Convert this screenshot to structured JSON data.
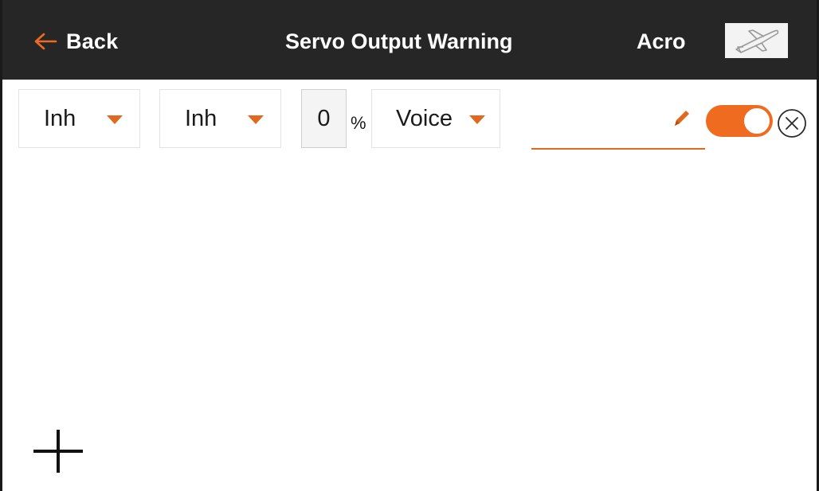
{
  "header": {
    "back_label": "Back",
    "title": "Servo Output Warning",
    "model_name": "Acro",
    "model_icon": "airplane-icon"
  },
  "row": {
    "dropdown_1": "Inh",
    "dropdown_2": "Inh",
    "value": "0",
    "unit": "%",
    "alert_type": "Voice",
    "text_value": "",
    "toggle_on": true
  },
  "colors": {
    "accent": "#ee6b1f",
    "header_bg": "#262626",
    "header_text": "#ffffff"
  },
  "icons": {
    "back": "arrow-left-icon",
    "edit": "pencil-icon",
    "remove": "close-circle-icon",
    "add": "plus-icon"
  }
}
